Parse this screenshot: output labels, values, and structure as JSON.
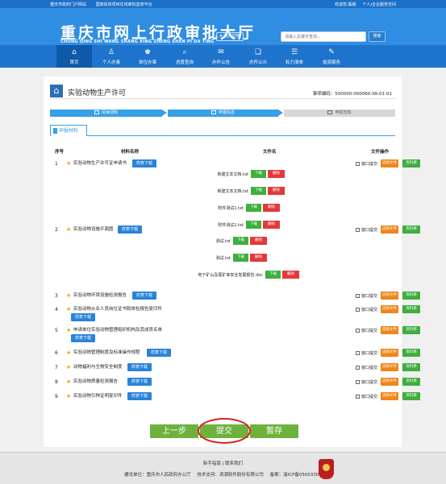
{
  "topbar": {
    "left_links": [
      "重庆市政府门户网站",
      "国家投资项目在线审批监管平台"
    ],
    "right_text": "欢迎您,殷毅",
    "user_space": "个人/企业服务空间"
  },
  "header": {
    "logo_cn": "重庆市网上行政审批大厅",
    "logo_en_words": [
      "CHONG",
      "QING",
      "SHI",
      "WANG",
      "SHANG",
      "XING",
      "ZHENG",
      "SHEN",
      "PI",
      "DA",
      "TING"
    ],
    "site_switch": "站点切换",
    "search_placeholder": "请输入关键字查询...",
    "search_button": "搜索"
  },
  "nav": [
    {
      "label": "首页",
      "icon": "home-icon",
      "glyph": "⌂",
      "active": true
    },
    {
      "label": "个人办事",
      "icon": "person-icon",
      "glyph": "♙",
      "active": false
    },
    {
      "label": "单位办事",
      "icon": "group-icon",
      "glyph": "♚",
      "active": false
    },
    {
      "label": "进度查询",
      "icon": "search-icon",
      "glyph": "⌕",
      "active": false
    },
    {
      "label": "办件公告",
      "icon": "announcement-icon",
      "glyph": "✉",
      "active": false
    },
    {
      "label": "办件公示",
      "icon": "public-notice-icon",
      "glyph": "❏",
      "active": false
    },
    {
      "label": "权力清单",
      "icon": "power-list-icon",
      "glyph": "☰",
      "active": false
    },
    {
      "label": "投资服务",
      "icon": "investment-service-icon",
      "glyph": "✎",
      "active": false
    }
  ],
  "page": {
    "title": "实验动物生产许可",
    "item_code_label": "事项编码：",
    "item_code": "500000-000060-XK-01-01"
  },
  "steps": [
    "阅读须知",
    "申报信息",
    "申报告知"
  ],
  "section_tab": "申报材料",
  "table_headers": {
    "seq": "序号",
    "material": "材料名称",
    "file": "文件名",
    "ops": "文件操作"
  },
  "labels": {
    "sample_download": "样表下载",
    "window_submit": "窗口提交",
    "select_file": "选择文件",
    "material_library": "资料库",
    "download": "下载",
    "delete": "删除"
  },
  "materials": [
    {
      "seq": "1",
      "name": "实验动物生产许可证申请书",
      "name2": ""
    },
    {
      "seq": "2",
      "name": "实验动物设施平面图",
      "name2": ""
    },
    {
      "seq": "3",
      "name": "实验动物环境设施检测报告",
      "name2": ""
    },
    {
      "seq": "4",
      "name": "实验动物从业人员岗位证书和体检报告复印件",
      "name2": ""
    },
    {
      "seq": "5",
      "name": "申请单位实验动物管理组织机构及其成员名单",
      "name2": ""
    },
    {
      "seq": "6",
      "name": "实验动物管理制度及标准操作规程",
      "name2": ""
    },
    {
      "seq": "7",
      "name": "动物福利与生物安全制度",
      "name2": ""
    },
    {
      "seq": "8",
      "name": "实验动物质量检测报告",
      "name2": ""
    },
    {
      "seq": "9",
      "name": "实验动物引种证明复印件",
      "name2": ""
    }
  ],
  "files": [
    "新建文本文档.txt",
    "新建文本文档.txt",
    "附件测试1.txt",
    "附件测试1.txt",
    "测试.txt",
    "测试.txt",
    "地下矿山及尾矿库安全发展报告.doc"
  ],
  "buttons": {
    "prev": "上一步",
    "submit": "提交",
    "save": "暂存"
  },
  "footer": {
    "links": "新手指南 | 联系我们",
    "builder": "建设单位：重庆市人民政府办公厅",
    "tech": "技术支持：浪潮软件股份有限公司",
    "icp": "备案：渝ICP备05003300"
  },
  "colors": {
    "primary": "#2f8de2",
    "nav": "#1e74cc",
    "green": "#6eb23e",
    "orange": "#f0851a",
    "red": "#e23a3a"
  }
}
